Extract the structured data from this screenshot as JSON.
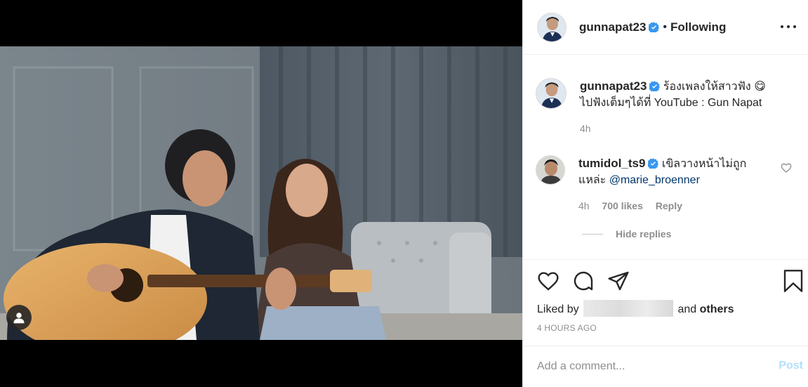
{
  "post": {
    "author": "gunnapat23",
    "follow_state": "Following",
    "separator": "•"
  },
  "caption": {
    "username": "gunnapat23",
    "line1": "ร้องเพลงให้สาวฟัง 😋",
    "line2": "ไปฟังเต็มๆได้ที่ YouTube : Gun Napat",
    "time": "4h"
  },
  "comments": [
    {
      "username": "tumidol_ts9",
      "text_line1": "เขิลวางหน้าไม่ถูก",
      "text_line2_prefix": "แหล่ะ ",
      "mention": "@marie_broenner",
      "time": "4h",
      "likes": "700 likes",
      "reply_label": "Reply"
    }
  ],
  "hide_replies_label": "Hide replies",
  "likes": {
    "prefix": "Liked by",
    "connector": "and",
    "others": "others"
  },
  "timestamp": "4 HOURS AGO",
  "composer": {
    "placeholder": "Add a comment...",
    "post_label": "Post"
  },
  "colors": {
    "verified": "#3897f0",
    "post_disabled": "#b2dffc",
    "mention": "#00376b"
  }
}
